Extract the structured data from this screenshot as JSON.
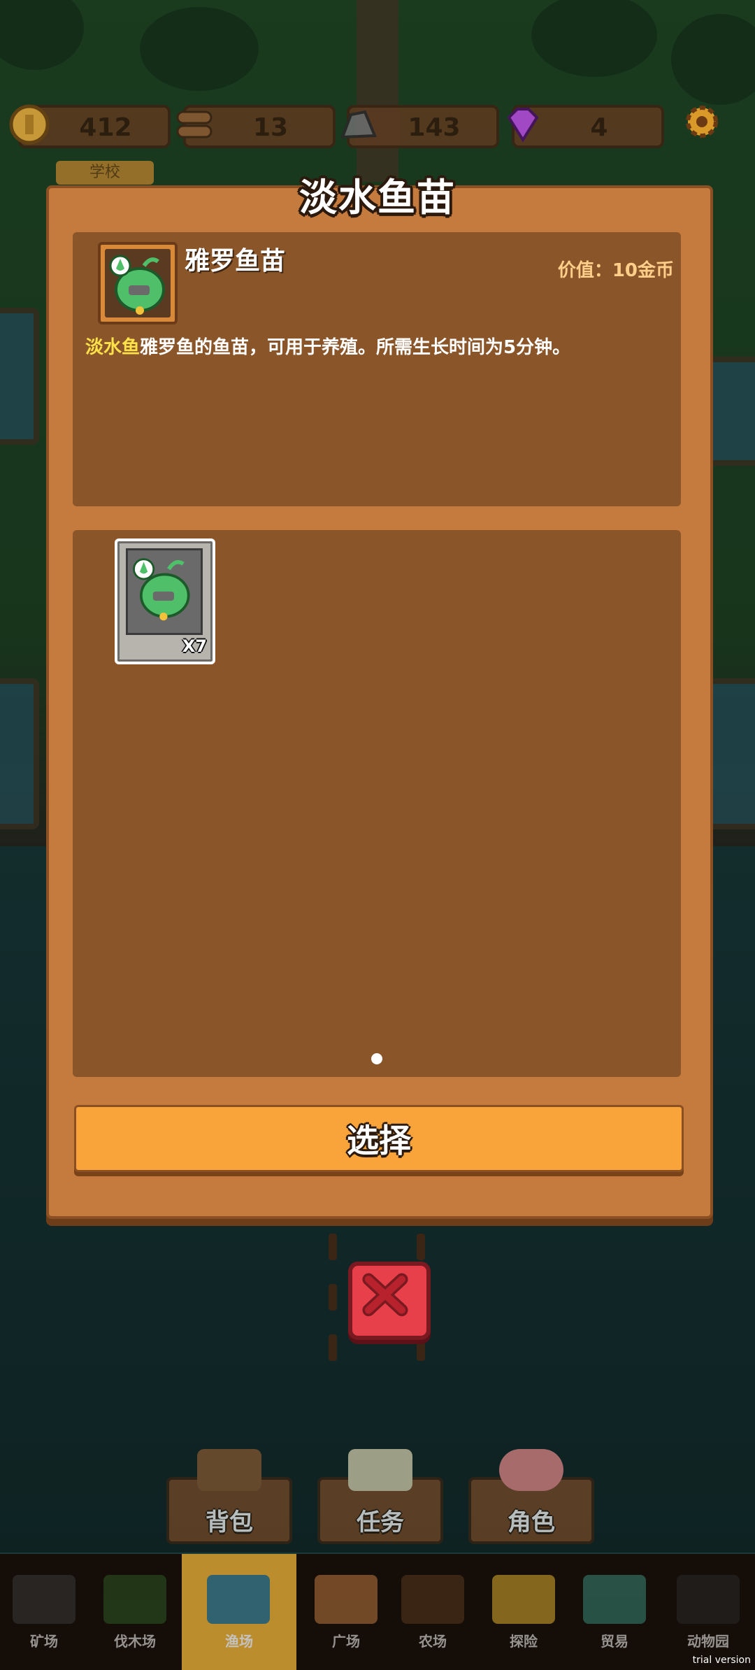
{
  "resources": [
    {
      "name": "coin",
      "value": "412",
      "color": "#d9a33a"
    },
    {
      "name": "wood",
      "value": "13",
      "color": "#8a5a32"
    },
    {
      "name": "stone",
      "value": "143",
      "color": "#6b6b6b"
    },
    {
      "name": "gem",
      "value": "4",
      "color": "#b04ad8"
    }
  ],
  "map_tag": "学校",
  "modal": {
    "title": "淡水鱼苗",
    "item": {
      "name": "雅罗鱼苗",
      "price": "价值：10金币",
      "desc_tag": "淡水鱼",
      "desc_text": "雅罗鱼的鱼苗，可用于养殖。所需生长时间为5分钟。",
      "icon": "fish-fry-icon"
    },
    "inventory": [
      {
        "icon": "fish-fry-icon",
        "qty": "X7"
      }
    ],
    "select_label": "选择"
  },
  "actions": [
    {
      "label": "背包",
      "icon": "backpack-icon"
    },
    {
      "label": "任务",
      "icon": "task-board-icon"
    },
    {
      "label": "角色",
      "icon": "pig-character-icon"
    }
  ],
  "tabs": [
    {
      "label": "矿场",
      "active": false
    },
    {
      "label": "伐木场",
      "active": false
    },
    {
      "label": "渔场",
      "active": true
    },
    {
      "label": "广场",
      "active": false
    },
    {
      "label": "农场",
      "active": false
    },
    {
      "label": "探险",
      "active": false
    },
    {
      "label": "贸易",
      "active": false
    },
    {
      "label": "动物园",
      "active": false
    }
  ],
  "watermark": "trial version",
  "colors": {
    "panel": "#8a5529",
    "frame": "#c57a3e",
    "button": "#f9a43a",
    "close": "#e8404a",
    "highlight": "#ffe14a"
  }
}
